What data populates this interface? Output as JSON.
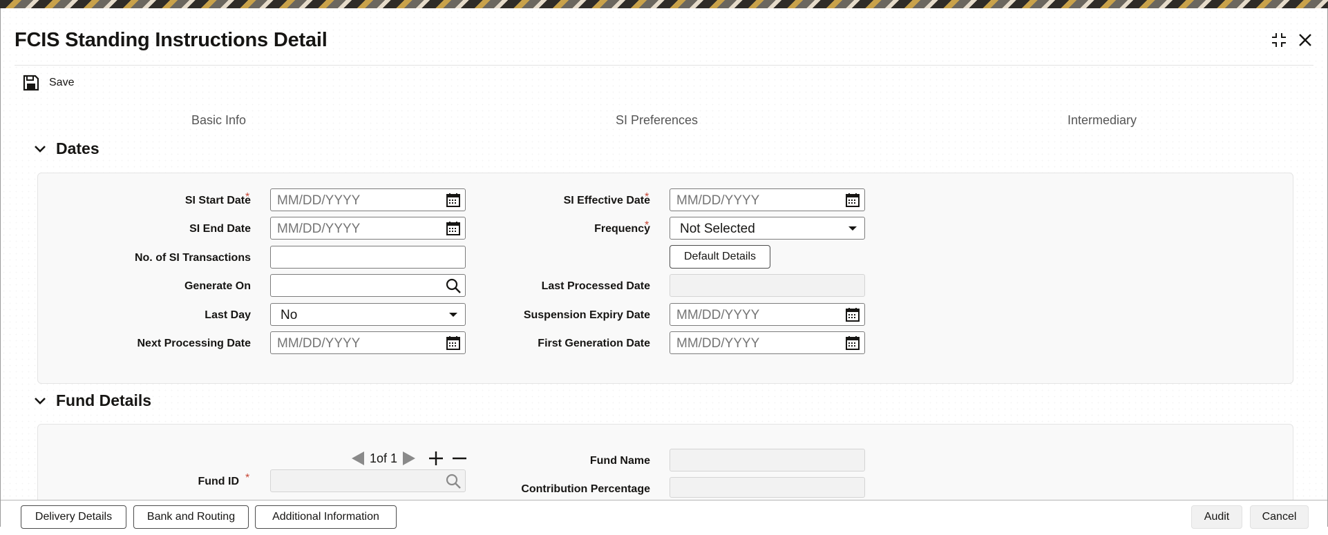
{
  "window": {
    "title": "FCIS Standing Instructions Detail"
  },
  "toolbar": {
    "save_label": "Save"
  },
  "tabs": [
    "Basic Info",
    "SI Preferences",
    "Intermediary"
  ],
  "dates_section": {
    "title": "Dates",
    "si_start_date": {
      "label": "SI Start Date",
      "placeholder": "MM/DD/YYYY"
    },
    "si_end_date": {
      "label": "SI End Date",
      "placeholder": "MM/DD/YYYY"
    },
    "no_of_si_transactions": {
      "label": "No. of SI Transactions",
      "value": ""
    },
    "generate_on": {
      "label": "Generate On",
      "value": ""
    },
    "last_day": {
      "label": "Last Day",
      "value": "No"
    },
    "next_processing_date": {
      "label": "Next Processing Date",
      "placeholder": "MM/DD/YYYY"
    },
    "si_effective_date": {
      "label": "SI Effective Date",
      "placeholder": "MM/DD/YYYY"
    },
    "frequency": {
      "label": "Frequency",
      "value": "Not Selected"
    },
    "default_details_label": "Default Details",
    "last_processed_date": {
      "label": "Last Processed Date",
      "value": ""
    },
    "suspension_expiry_date": {
      "label": "Suspension Expiry Date",
      "placeholder": "MM/DD/YYYY"
    },
    "first_generation_date": {
      "label": "First Generation Date",
      "placeholder": "MM/DD/YYYY"
    },
    "required_marker": "*"
  },
  "fund_section": {
    "title": "Fund Details",
    "pager_text": "1of 1",
    "fund_id": {
      "label": "Fund ID",
      "value": ""
    },
    "fund_name": {
      "label": "Fund Name",
      "value": ""
    },
    "contribution_percentage": {
      "label": "Contribution Percentage",
      "value": ""
    }
  },
  "footer": {
    "delivery_details": "Delivery Details",
    "bank_and_routing": "Bank and Routing",
    "additional_information": "Additional Information",
    "audit": "Audit",
    "cancel": "Cancel"
  },
  "colors": {
    "required": "#c74634",
    "text": "#161513"
  }
}
